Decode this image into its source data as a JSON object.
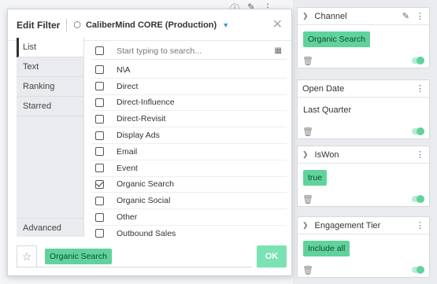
{
  "modal": {
    "title": "Edit Filter",
    "source_label": "CaliberMind CORE (Production)",
    "tabs": [
      {
        "label": "List",
        "active": true
      },
      {
        "label": "Text",
        "active": false
      },
      {
        "label": "Ranking",
        "active": false
      },
      {
        "label": "Starred",
        "active": false
      }
    ],
    "advanced_label": "Advanced",
    "search_placeholder": "Start typing to search...",
    "options": [
      {
        "label": "N\\A",
        "checked": false
      },
      {
        "label": "Direct",
        "checked": false
      },
      {
        "label": "Direct-Influence",
        "checked": false
      },
      {
        "label": "Direct-Revisit",
        "checked": false
      },
      {
        "label": "Display Ads",
        "checked": false
      },
      {
        "label": "Email",
        "checked": false
      },
      {
        "label": "Event",
        "checked": false
      },
      {
        "label": "Organic Search",
        "checked": true
      },
      {
        "label": "Organic Social",
        "checked": false
      },
      {
        "label": "Other",
        "checked": false
      },
      {
        "label": "Outbound Sales",
        "checked": false
      }
    ],
    "selected_chip": "Organic Search",
    "ok_label": "OK"
  },
  "cards": [
    {
      "title": "Channel",
      "value": "Organic Search",
      "style": "chip"
    },
    {
      "title": "Open Date",
      "value": "Last Quarter",
      "style": "plain"
    },
    {
      "title": "IsWon",
      "value": "true",
      "style": "chip"
    },
    {
      "title": "Engagement Tier",
      "value": "Include all",
      "style": "chip"
    }
  ],
  "colors": {
    "accent_green": "#5fd39b",
    "ok_green": "#7be2b3",
    "caret_blue": "#3a9ad9"
  },
  "icons": [
    "info-icon",
    "pencil-icon",
    "kebab-icon",
    "chevron-right-icon",
    "trash-icon",
    "toggle-icon",
    "cube-icon",
    "caret-down-icon",
    "close-icon",
    "grid-icon",
    "star-icon",
    "checkbox-icon"
  ]
}
